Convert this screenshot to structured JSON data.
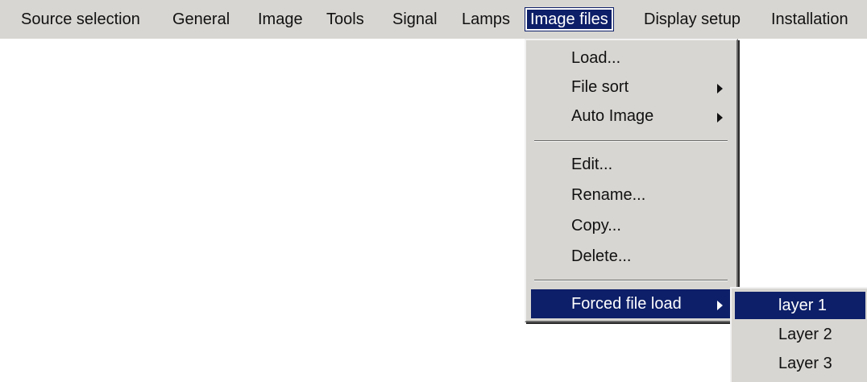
{
  "menubar": {
    "items": [
      {
        "label": "Source selection"
      },
      {
        "label": "General"
      },
      {
        "label": "Image"
      },
      {
        "label": "Tools"
      },
      {
        "label": "Signal"
      },
      {
        "label": "Lamps"
      },
      {
        "label": "Image files",
        "active": true
      },
      {
        "label": "Display setup"
      },
      {
        "label": "Installation"
      }
    ]
  },
  "image_files_menu": {
    "items": [
      {
        "label": "Load..."
      },
      {
        "label": "File sort",
        "has_submenu": true
      },
      {
        "label": "Auto Image",
        "has_submenu": true
      },
      {
        "label": "Edit..."
      },
      {
        "label": "Rename..."
      },
      {
        "label": "Copy..."
      },
      {
        "label": "Delete..."
      },
      {
        "label": "Forced file load",
        "has_submenu": true,
        "highlighted": true
      }
    ]
  },
  "forced_file_load_submenu": {
    "items": [
      {
        "label": "layer 1",
        "highlighted": true
      },
      {
        "label": "Layer 2"
      },
      {
        "label": "Layer 3"
      }
    ]
  },
  "colors": {
    "menu_background": "#d8d6d2",
    "highlight": "#0d1f68",
    "highlight_text": "#ffffff",
    "text": "#111111",
    "page_background": "#ffffff"
  }
}
